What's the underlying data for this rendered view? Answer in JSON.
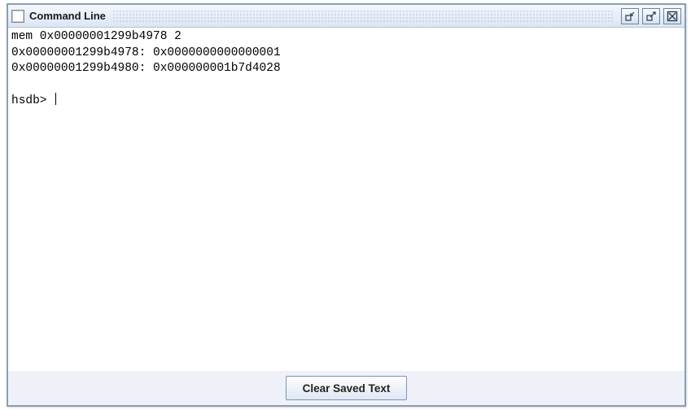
{
  "window": {
    "title": "Command Line"
  },
  "console": {
    "lines": [
      "mem 0x00000001299b4978 2",
      "0x00000001299b4978: 0x0000000000000001",
      "0x00000001299b4980: 0x000000001b7d4028",
      ""
    ],
    "prompt": "hsdb> "
  },
  "buttons": {
    "clear": "Clear Saved Text"
  },
  "icons": {
    "minimize": "minimize",
    "maximize": "maximize",
    "close": "close"
  }
}
